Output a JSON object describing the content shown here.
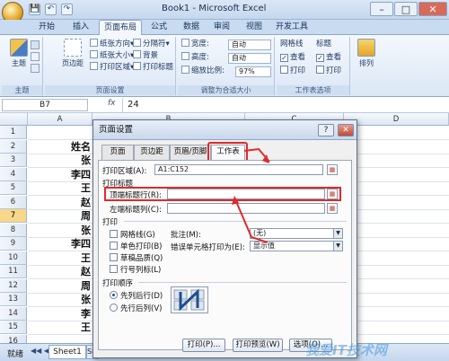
{
  "window": {
    "title": "Book1 - Microsoft Excel"
  },
  "quick_access": {
    "save": "💾",
    "undo": "↶",
    "redo": "↷"
  },
  "window_buttons": {
    "minimize": "–",
    "maximize": "□",
    "close": "✕"
  },
  "ribbon_tabs": [
    "开始",
    "插入",
    "页面布局",
    "公式",
    "数据",
    "审阅",
    "视图",
    "开发工具"
  ],
  "ribbon": {
    "theme": {
      "theme_label": "主题",
      "group": "主题"
    },
    "page_setup": {
      "margins": "页边距",
      "orientation": "纸张方向",
      "size": "纸张大小",
      "print_area": "打印区域",
      "breaks": "分隔符",
      "background": "背景",
      "print_titles": "打印标题",
      "group": "页面设置"
    },
    "scale": {
      "width_label": "宽度:",
      "width_value": "自动",
      "height_label": "高度:",
      "height_value": "自动",
      "scale_label": "缩放比例:",
      "scale_value": "97%",
      "group": "调整为合适大小"
    },
    "sheet_options": {
      "gridlines": "网格线",
      "headings": "标题",
      "view": "查看",
      "print": "打印",
      "group": "工作表选项"
    },
    "arrange": {
      "label": "排列"
    }
  },
  "formula_bar": {
    "name_box": "B7",
    "fx": "fx",
    "value": "24"
  },
  "columns": [
    "A",
    "B",
    "C",
    "D"
  ],
  "rows": [
    "1",
    "2",
    "3",
    "4",
    "5",
    "6",
    "7",
    "8",
    "9",
    "10",
    "11",
    "12",
    "13",
    "14",
    "15",
    "16"
  ],
  "selected_row": "7",
  "cells_a": [
    "",
    "姓名",
    "张",
    "李四",
    "王",
    "赵",
    "周",
    "张",
    "李四",
    "王",
    "赵",
    "周",
    "张",
    "李",
    "王",
    ""
  ],
  "sheet_tabs": {
    "active": "Sheet1",
    "next": "Sh"
  },
  "status": {
    "ready": "就绪"
  },
  "dialog": {
    "title": "页面设置",
    "help": "?",
    "close": "✕",
    "tabs": [
      "页面",
      "页边距",
      "页眉/页脚",
      "工作表"
    ],
    "print_area_label": "打印区域(A):",
    "print_area_value": "A1:C152",
    "print_titles_section": "打印标题",
    "top_rows_label": "顶端标题行(R):",
    "top_rows_value": "",
    "left_cols_label": "左端标题列(C):",
    "left_cols_value": "",
    "print_section": "打印",
    "gridlines": "网格线(G)",
    "black_white": "单色打印(B)",
    "draft": "草稿品质(Q)",
    "row_col_headings": "行号列标(L)",
    "comments_label": "批注(M):",
    "comments_value": "(无)",
    "errors_label": "错误单元格打印为(E):",
    "errors_value": "显示值",
    "order_section": "打印顺序",
    "down_then_over": "先列后行(D)",
    "over_then_down": "先行后列(V)",
    "btn_print": "打印(P)...",
    "btn_preview": "打印预览(W)",
    "btn_options": "选项(O)..."
  },
  "watermark": "我爱IT技术网",
  "colors": {
    "ribbon_bg": "#dbe7f5",
    "selected_row": "#f8d78a",
    "highlight": "#e02a2a"
  }
}
